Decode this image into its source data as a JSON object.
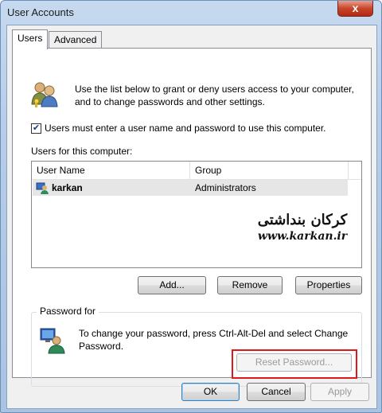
{
  "window": {
    "title": "User Accounts",
    "close_label": "x"
  },
  "tabs": [
    {
      "label": "Users",
      "active": true
    },
    {
      "label": "Advanced",
      "active": false
    }
  ],
  "users_tab": {
    "intro_text": "Use the list below to grant or deny users access to your computer, and to change passwords and other settings.",
    "require_login_checkbox": {
      "label": "Users must enter a user name and password to use this computer.",
      "checked": true
    },
    "list_label": "Users for this computer:",
    "columns": [
      "User Name",
      "Group"
    ],
    "rows": [
      {
        "user": "karkan",
        "group": "Administrators"
      }
    ],
    "buttons": {
      "add": "Add...",
      "remove": "Remove",
      "properties": "Properties"
    },
    "password_group": {
      "label": "Password for",
      "text": "To change your password, press Ctrl-Alt-Del and select Change Password.",
      "reset_button": "Reset Password..."
    }
  },
  "watermark": {
    "script_text": "کرکان بنداشتی",
    "url": "www.karkan.ir"
  },
  "footer_buttons": {
    "ok": "OK",
    "cancel": "Cancel",
    "apply": "Apply"
  },
  "colors": {
    "highlight": "#e0181b",
    "selected_row": "#e6e6e6"
  }
}
